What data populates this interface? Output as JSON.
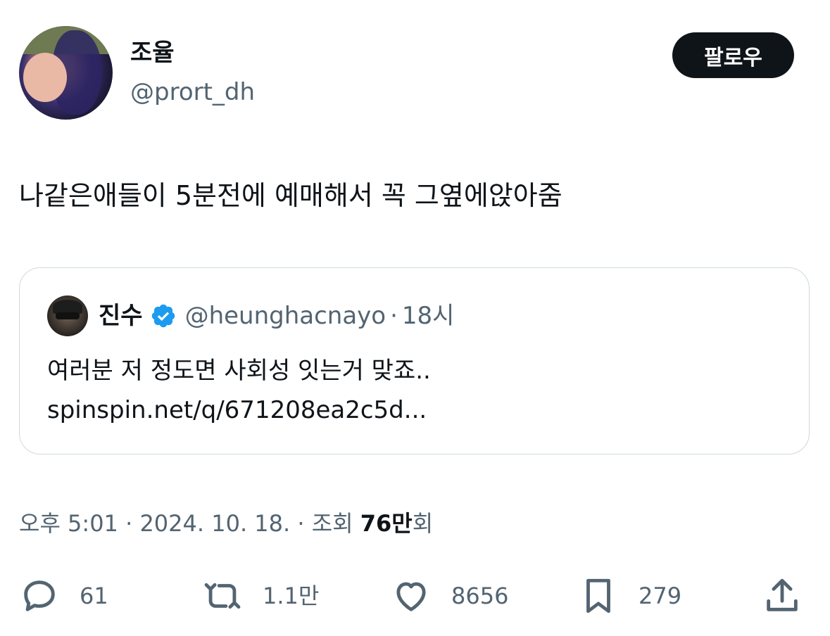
{
  "author": {
    "display_name": "조율",
    "handle": "@prort_dh",
    "avatar_icon": "profile-photo"
  },
  "follow_label": "팔로우",
  "tweet": {
    "text": "나같은애들이 5분전에 예매해서 꼭 그옆에앉아줌"
  },
  "quoted": {
    "name": "진수",
    "verified_icon": "verified-badge-icon",
    "verified_color": "#1d9bf0",
    "handle": "@heunghacnayo",
    "separator": "·",
    "time": "18시",
    "text": "여러분 저 정도면 사회성 잇는거 맞죠..",
    "link": "spinspin.net/q/671208ea2c5d..."
  },
  "meta": {
    "time": "오후 5:01",
    "sep1": "·",
    "date": "2024. 10. 18.",
    "sep2": "·",
    "views_label": "조회",
    "views_count": "76만",
    "views_suffix": "회"
  },
  "actions": {
    "reply_icon": "reply-icon",
    "reply_count": "61",
    "retweet_icon": "retweet-icon",
    "retweet_count": "1.1만",
    "like_icon": "heart-icon",
    "like_count": "8656",
    "bookmark_icon": "bookmark-icon",
    "bookmark_count": "279",
    "share_icon": "share-icon"
  },
  "colors": {
    "text_primary": "#0f1419",
    "text_secondary": "#536471",
    "border": "#cfd9de",
    "button_bg": "#0f1419",
    "accent": "#1d9bf0"
  }
}
